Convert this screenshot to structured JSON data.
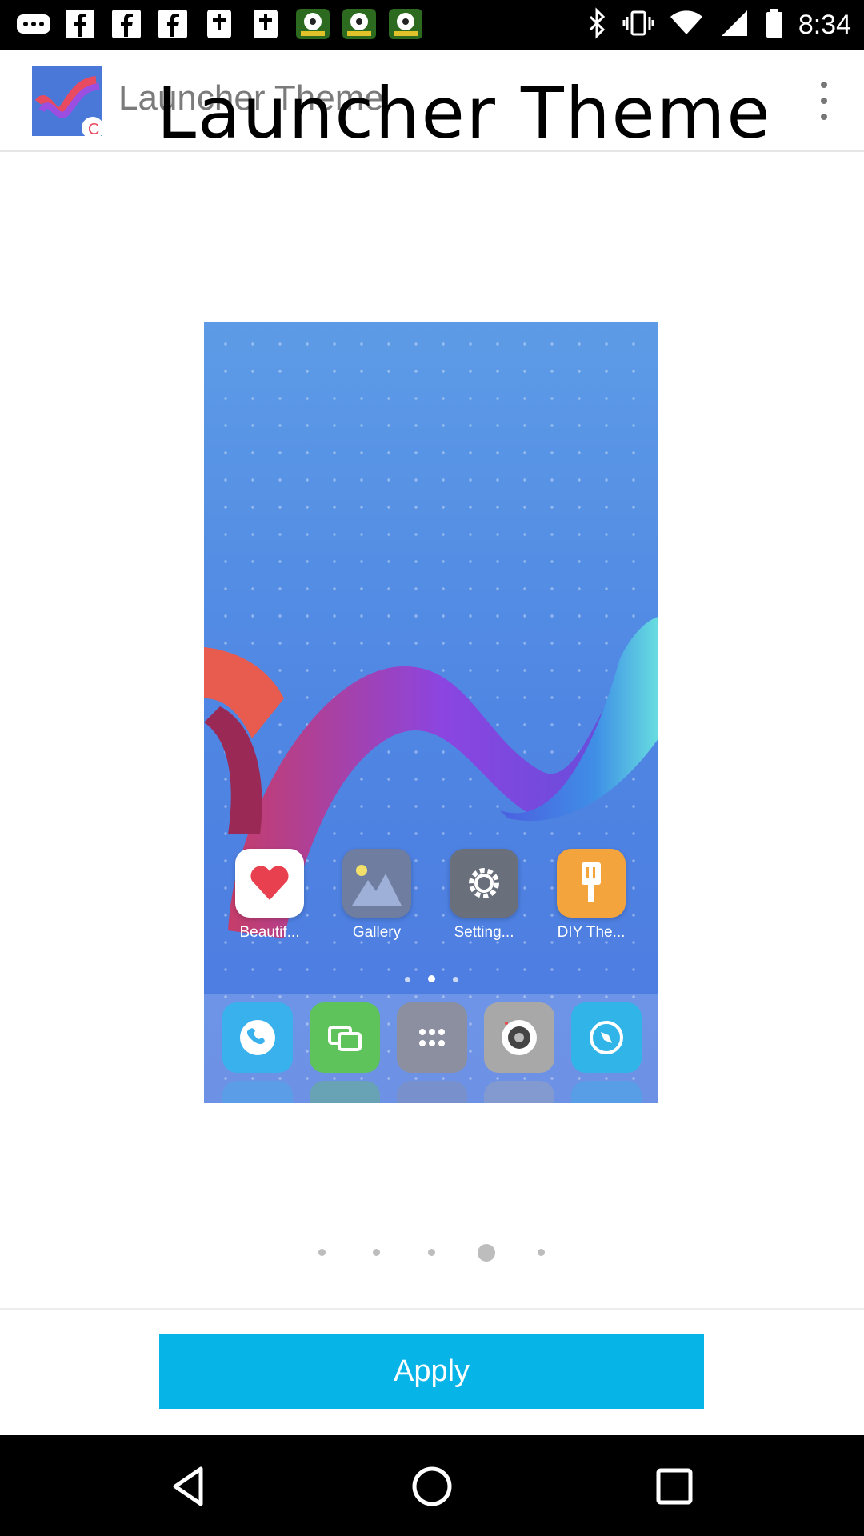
{
  "status_bar": {
    "time": "8:34",
    "left_icons": [
      "more-dots-icon",
      "facebook-icon",
      "facebook-icon",
      "facebook-icon",
      "bible-icon",
      "bible-icon",
      "soccer-game-icon",
      "soccer-game-icon",
      "soccer-game-icon"
    ],
    "right_icons": [
      "bluetooth-icon",
      "vibrate-icon",
      "wifi-icon",
      "signal-icon",
      "battery-icon"
    ]
  },
  "app_bar": {
    "title_small": "Launcher Theme",
    "title_large": "Launcher Theme",
    "menu_icon": "more-vert-icon"
  },
  "preview": {
    "apps": [
      {
        "label": "Beautif...",
        "icon": "heart-icon",
        "color": "#ffffff"
      },
      {
        "label": "Gallery",
        "icon": "mountain-icon",
        "color": "#6f7da0"
      },
      {
        "label": "Setting...",
        "icon": "gear-icon",
        "color": "#6a6f7c"
      },
      {
        "label": "DIY The...",
        "icon": "paintbrush-icon",
        "color": "#f4a43c"
      }
    ],
    "dock": [
      {
        "icon": "phone-icon",
        "color": "#39b1ec"
      },
      {
        "icon": "message-icon",
        "color": "#5dc35a"
      },
      {
        "icon": "app-drawer-icon",
        "color": "#8c8fa0"
      },
      {
        "icon": "camera-icon",
        "color": "#a8a8a8"
      },
      {
        "icon": "browser-icon",
        "color": "#31b4e8"
      }
    ]
  },
  "carousel": {
    "count": 5,
    "active_index": 3
  },
  "actions": {
    "apply_label": "Apply"
  },
  "colors": {
    "accent": "#06b4e8"
  }
}
